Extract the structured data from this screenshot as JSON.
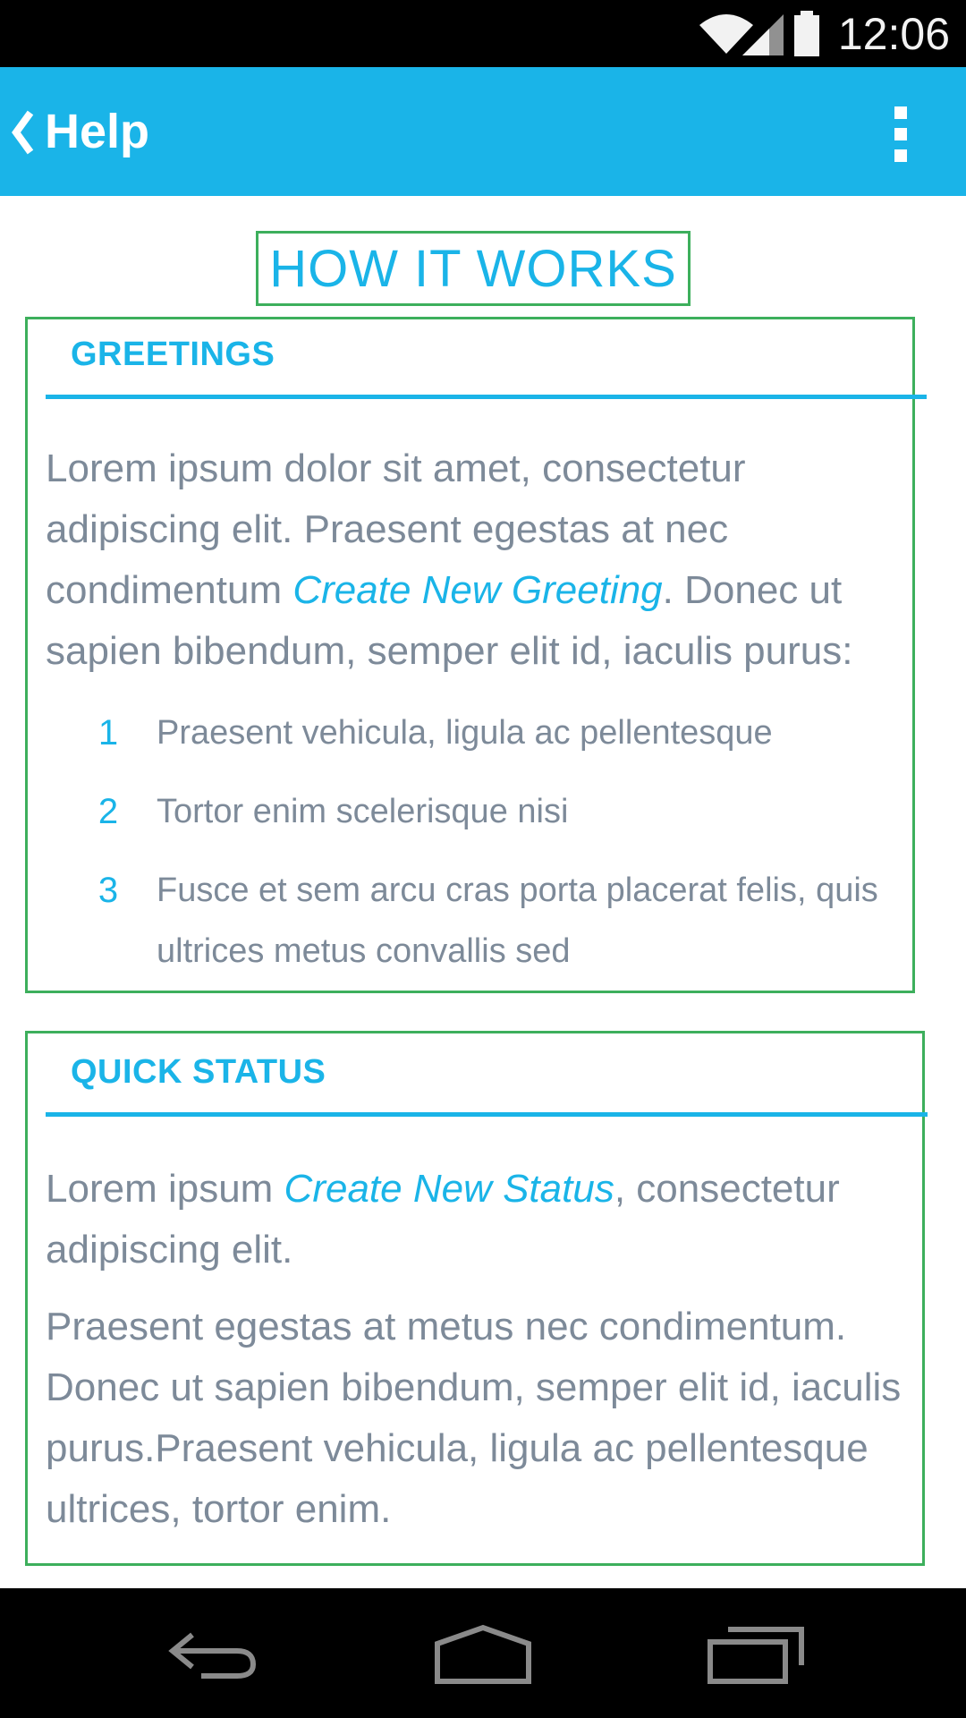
{
  "colors": {
    "accent": "#1ab4e8",
    "body_text": "#7d8a99",
    "outline": "#3daf5c"
  },
  "status_bar": {
    "time": "12:06",
    "icons": [
      "wifi-icon",
      "signal-icon",
      "battery-icon"
    ]
  },
  "app_bar": {
    "back_icon": "chevron-left-icon",
    "title": "Help",
    "menu_icon": "overflow-menu-icon"
  },
  "page_title": "HOW IT WORKS",
  "greetings": {
    "heading": "GREETINGS",
    "intro_before_link": "Lorem ipsum dolor sit amet, consectetur adipiscing elit. Praesent egestas at nec condimentum ",
    "link": "Create New Greeting",
    "intro_after_link": ". Donec ut sapien bibendum, semper elit id, iaculis purus:",
    "items": [
      {
        "number": "1",
        "text": "Praesent vehicula, ligula ac pellentesque"
      },
      {
        "number": "2",
        "text": "Tortor enim scelerisque nisi"
      },
      {
        "number": "3",
        "text": "Fusce et sem arcu cras porta placerat felis, quis ultrices metus convallis sed"
      }
    ]
  },
  "quick_status": {
    "heading": "QUICK STATUS",
    "p1_before_link": "Lorem ipsum ",
    "link": "Create New Status",
    "p1_after_link": ", consectetur adipiscing elit.",
    "p2": "Praesent egestas at metus nec condimentum. Donec ut sapien bibendum, semper elit id, iaculis purus.Praesent vehicula, ligula ac pellentesque ultrices, tortor enim."
  },
  "nav_bar": {
    "buttons": [
      "back-icon",
      "home-icon",
      "recent-apps-icon"
    ]
  }
}
